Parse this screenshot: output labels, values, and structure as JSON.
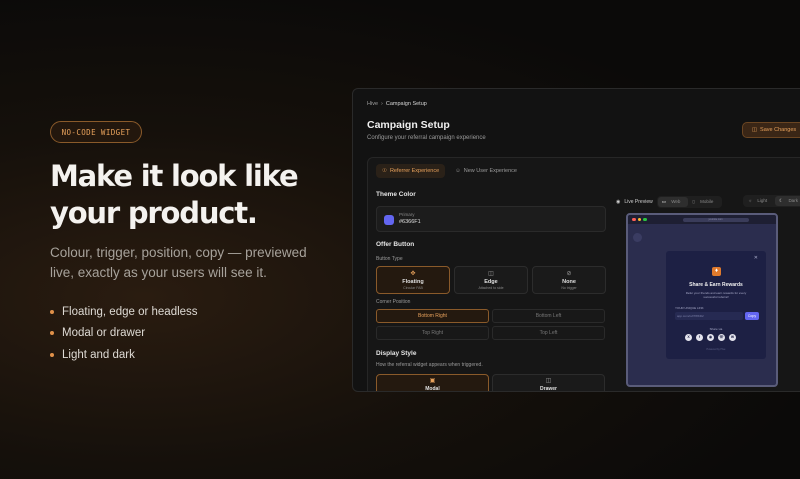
{
  "hero": {
    "badge": "NO-CODE WIDGET",
    "headline_line1": "Make it look like",
    "headline_line2": "your product.",
    "subhead_line1": "Colour, trigger, position, copy — previewed",
    "subhead_line2": "live, exactly as your users will see it.",
    "features": [
      "Floating, edge or headless",
      "Modal or drawer",
      "Light and dark"
    ]
  },
  "app": {
    "breadcrumb": {
      "root": "Hive",
      "sep": "›",
      "current": "Campaign Setup"
    },
    "title": "Campaign Setup",
    "subtitle": "Configure your referral campaign experience",
    "save_label": "Save Changes",
    "tabs": [
      {
        "label": "Referrer Experience",
        "active": true
      },
      {
        "label": "New User Experience",
        "active": false
      }
    ],
    "theme": {
      "section": "Theme Color",
      "label": "Primary",
      "hex": "#6366F1",
      "color": "#6366f1"
    },
    "offer_button": {
      "section": "Offer Button",
      "type_label": "Button Type",
      "types": [
        {
          "name": "Floating",
          "desc": "Circular FAB",
          "icon": "move-icon",
          "selected": true
        },
        {
          "name": "Edge",
          "desc": "Attached to side",
          "icon": "panel-icon",
          "selected": false
        },
        {
          "name": "None",
          "desc": "No trigger",
          "icon": "ban-icon",
          "selected": false
        }
      ],
      "position_label": "Corner Position",
      "positions": [
        "Bottom Right",
        "Bottom Left",
        "Top Right",
        "Top Left"
      ],
      "selected_position": "Bottom Right"
    },
    "display": {
      "section": "Display Style",
      "desc": "How the referral widget appears when triggered.",
      "options": [
        {
          "name": "Modal",
          "selected": true
        },
        {
          "name": "Drawer",
          "selected": false
        }
      ]
    },
    "preview": {
      "label": "Live Preview",
      "devices": [
        "Web",
        "Mobile"
      ],
      "selected_device": "Web",
      "themes": [
        "Light",
        "Dark"
      ],
      "selected_theme": "Dark",
      "url": "yoursite.com",
      "modal": {
        "title": "Share & Earn Rewards",
        "desc": "Refer your friends and earn rewards for every successful referral!",
        "link_label": "YOUR UNIQUE LINK",
        "link_value": "app.com/ref/7f8KD2",
        "copy_label": "Copy",
        "share_label": "Share via",
        "socials": [
          "x-icon",
          "facebook-icon",
          "instagram-icon",
          "whatsapp-icon",
          "email-icon"
        ],
        "footer": "Powered by Hive"
      }
    }
  },
  "colors": {
    "accent": "#e8a25c",
    "primary": "#6366f1",
    "bg": "#0b0a09"
  }
}
